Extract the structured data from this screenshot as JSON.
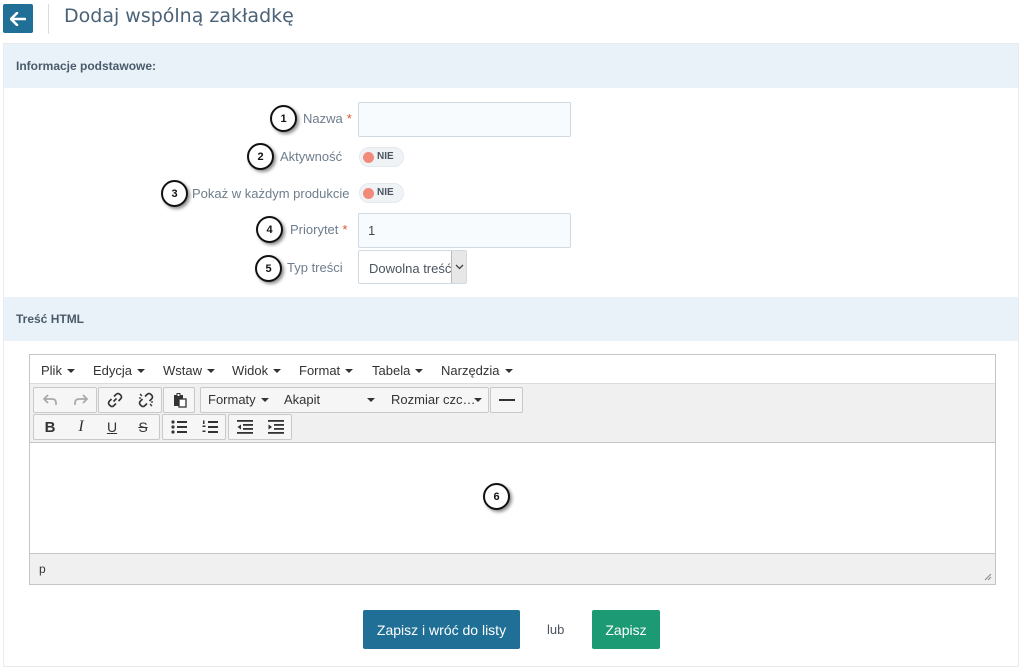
{
  "header": {
    "title": "Dodaj wspólną zakładkę"
  },
  "sections": {
    "basic": "Informacje podstawowe:",
    "html": "Treść HTML"
  },
  "form": {
    "name_label": "Nazwa",
    "name_value": "",
    "active_label": "Aktywność",
    "active_toggle": "NIE",
    "show_label": "Pokaż w każdym produkcie",
    "show_toggle": "NIE",
    "priority_label": "Priorytet",
    "priority_value": "1",
    "type_label": "Typ treści",
    "type_value": "Dowolna treść",
    "required_mark": "*"
  },
  "badges": [
    "1",
    "2",
    "3",
    "4",
    "5",
    "6"
  ],
  "editor": {
    "menu": [
      "Plik",
      "Edycja",
      "Wstaw",
      "Widok",
      "Format",
      "Tabela",
      "Narzędzia"
    ],
    "formats": "Formaty",
    "block": "Akapit",
    "font_size": "Rozmiar czc…",
    "status_path": "p"
  },
  "actions": {
    "save_and_return": "Zapisz i wróć do listy",
    "or": "lub",
    "save": "Zapisz"
  },
  "colors": {
    "primary": "#1f6f96",
    "success": "#1b9a73",
    "section_bg": "#eaf2f9",
    "required": "#e0532c",
    "toggle_off": "#f28a7a"
  },
  "icons": {
    "back": "arrow-left-icon",
    "undo": "undo-icon",
    "redo": "redo-icon",
    "link": "link-icon",
    "unlink": "unlink-icon",
    "paste": "paste-icon",
    "hr": "horizontal-rule-icon",
    "bold": "bold-icon",
    "italic": "italic-icon",
    "underline": "underline-icon",
    "strike": "strikethrough-icon",
    "bullist": "bullet-list-icon",
    "numlist": "numbered-list-icon",
    "outdent": "outdent-icon",
    "indent": "indent-icon"
  }
}
